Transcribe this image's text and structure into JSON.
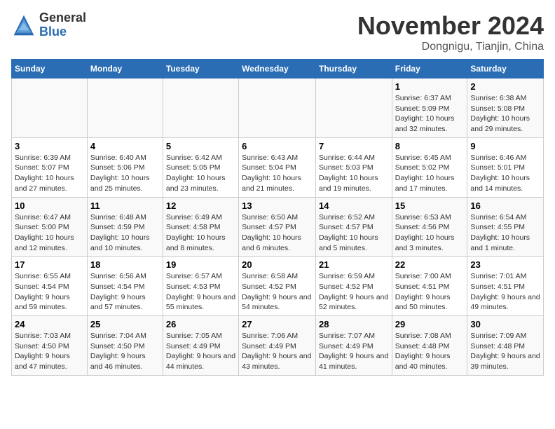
{
  "header": {
    "logo_general": "General",
    "logo_blue": "Blue",
    "month_title": "November 2024",
    "location": "Dongnigu, Tianjin, China"
  },
  "days_of_week": [
    "Sunday",
    "Monday",
    "Tuesday",
    "Wednesday",
    "Thursday",
    "Friday",
    "Saturday"
  ],
  "weeks": [
    [
      {
        "day": "",
        "info": ""
      },
      {
        "day": "",
        "info": ""
      },
      {
        "day": "",
        "info": ""
      },
      {
        "day": "",
        "info": ""
      },
      {
        "day": "",
        "info": ""
      },
      {
        "day": "1",
        "info": "Sunrise: 6:37 AM\nSunset: 5:09 PM\nDaylight: 10 hours and 32 minutes."
      },
      {
        "day": "2",
        "info": "Sunrise: 6:38 AM\nSunset: 5:08 PM\nDaylight: 10 hours and 29 minutes."
      }
    ],
    [
      {
        "day": "3",
        "info": "Sunrise: 6:39 AM\nSunset: 5:07 PM\nDaylight: 10 hours and 27 minutes."
      },
      {
        "day": "4",
        "info": "Sunrise: 6:40 AM\nSunset: 5:06 PM\nDaylight: 10 hours and 25 minutes."
      },
      {
        "day": "5",
        "info": "Sunrise: 6:42 AM\nSunset: 5:05 PM\nDaylight: 10 hours and 23 minutes."
      },
      {
        "day": "6",
        "info": "Sunrise: 6:43 AM\nSunset: 5:04 PM\nDaylight: 10 hours and 21 minutes."
      },
      {
        "day": "7",
        "info": "Sunrise: 6:44 AM\nSunset: 5:03 PM\nDaylight: 10 hours and 19 minutes."
      },
      {
        "day": "8",
        "info": "Sunrise: 6:45 AM\nSunset: 5:02 PM\nDaylight: 10 hours and 17 minutes."
      },
      {
        "day": "9",
        "info": "Sunrise: 6:46 AM\nSunset: 5:01 PM\nDaylight: 10 hours and 14 minutes."
      }
    ],
    [
      {
        "day": "10",
        "info": "Sunrise: 6:47 AM\nSunset: 5:00 PM\nDaylight: 10 hours and 12 minutes."
      },
      {
        "day": "11",
        "info": "Sunrise: 6:48 AM\nSunset: 4:59 PM\nDaylight: 10 hours and 10 minutes."
      },
      {
        "day": "12",
        "info": "Sunrise: 6:49 AM\nSunset: 4:58 PM\nDaylight: 10 hours and 8 minutes."
      },
      {
        "day": "13",
        "info": "Sunrise: 6:50 AM\nSunset: 4:57 PM\nDaylight: 10 hours and 6 minutes."
      },
      {
        "day": "14",
        "info": "Sunrise: 6:52 AM\nSunset: 4:57 PM\nDaylight: 10 hours and 5 minutes."
      },
      {
        "day": "15",
        "info": "Sunrise: 6:53 AM\nSunset: 4:56 PM\nDaylight: 10 hours and 3 minutes."
      },
      {
        "day": "16",
        "info": "Sunrise: 6:54 AM\nSunset: 4:55 PM\nDaylight: 10 hours and 1 minute."
      }
    ],
    [
      {
        "day": "17",
        "info": "Sunrise: 6:55 AM\nSunset: 4:54 PM\nDaylight: 9 hours and 59 minutes."
      },
      {
        "day": "18",
        "info": "Sunrise: 6:56 AM\nSunset: 4:54 PM\nDaylight: 9 hours and 57 minutes."
      },
      {
        "day": "19",
        "info": "Sunrise: 6:57 AM\nSunset: 4:53 PM\nDaylight: 9 hours and 55 minutes."
      },
      {
        "day": "20",
        "info": "Sunrise: 6:58 AM\nSunset: 4:52 PM\nDaylight: 9 hours and 54 minutes."
      },
      {
        "day": "21",
        "info": "Sunrise: 6:59 AM\nSunset: 4:52 PM\nDaylight: 9 hours and 52 minutes."
      },
      {
        "day": "22",
        "info": "Sunrise: 7:00 AM\nSunset: 4:51 PM\nDaylight: 9 hours and 50 minutes."
      },
      {
        "day": "23",
        "info": "Sunrise: 7:01 AM\nSunset: 4:51 PM\nDaylight: 9 hours and 49 minutes."
      }
    ],
    [
      {
        "day": "24",
        "info": "Sunrise: 7:03 AM\nSunset: 4:50 PM\nDaylight: 9 hours and 47 minutes."
      },
      {
        "day": "25",
        "info": "Sunrise: 7:04 AM\nSunset: 4:50 PM\nDaylight: 9 hours and 46 minutes."
      },
      {
        "day": "26",
        "info": "Sunrise: 7:05 AM\nSunset: 4:49 PM\nDaylight: 9 hours and 44 minutes."
      },
      {
        "day": "27",
        "info": "Sunrise: 7:06 AM\nSunset: 4:49 PM\nDaylight: 9 hours and 43 minutes."
      },
      {
        "day": "28",
        "info": "Sunrise: 7:07 AM\nSunset: 4:49 PM\nDaylight: 9 hours and 41 minutes."
      },
      {
        "day": "29",
        "info": "Sunrise: 7:08 AM\nSunset: 4:48 PM\nDaylight: 9 hours and 40 minutes."
      },
      {
        "day": "30",
        "info": "Sunrise: 7:09 AM\nSunset: 4:48 PM\nDaylight: 9 hours and 39 minutes."
      }
    ]
  ]
}
